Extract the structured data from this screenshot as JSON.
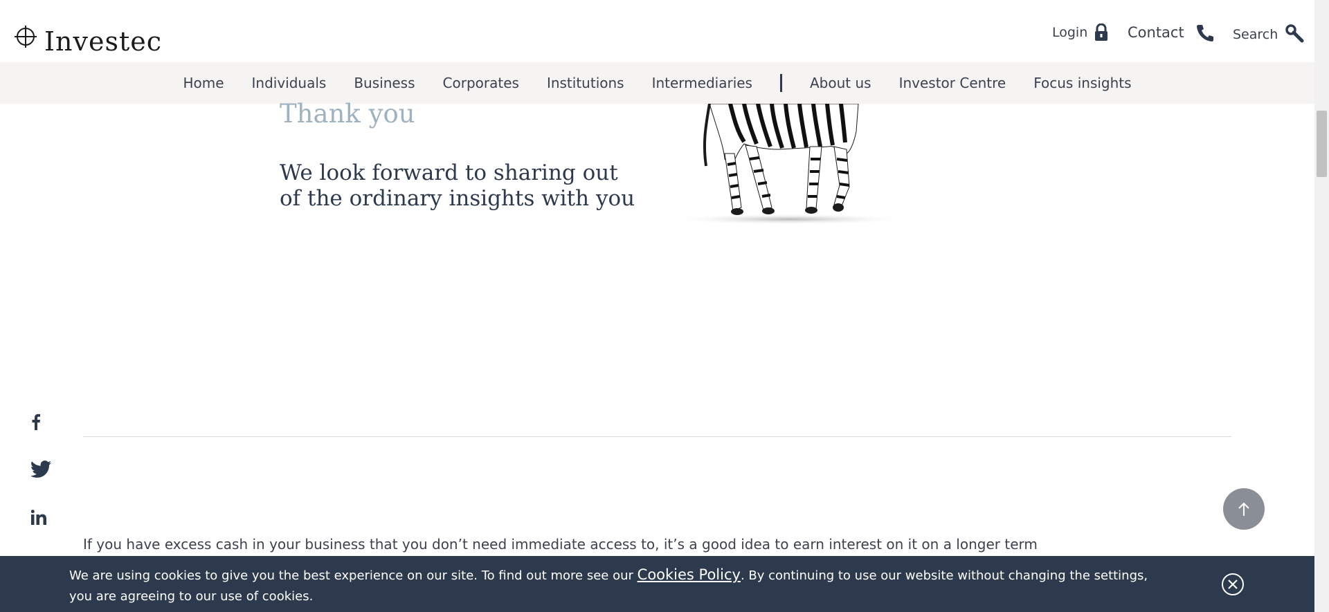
{
  "header": {
    "logo_text": "Investec",
    "login_label": "Login",
    "contact_label": "Contact",
    "search_label": "Search"
  },
  "nav": {
    "items": [
      "Home",
      "Individuals",
      "Business",
      "Corporates",
      "Institutions",
      "Intermediaries"
    ],
    "secondary_items": [
      "About us",
      "Investor Centre",
      "Focus insights"
    ]
  },
  "content": {
    "thanks_title": "Thank you",
    "thanks_body": "We look forward to sharing out of the ordinary insights with you",
    "body_text": "If you have excess cash in your business that you don’t need immediate access to, it’s a good idea to earn interest on it on a longer term"
  },
  "social": {
    "icons": [
      "facebook-icon",
      "twitter-icon",
      "linkedin-icon"
    ]
  },
  "cookie_bar": {
    "text_before": "We are using cookies to give you the best experience on our site. To find out more see our ",
    "link_label": "Cookies Policy",
    "text_after": ". By continuing to use our website without changing the settings, you are agreeing to our use of cookies."
  },
  "colors": {
    "nav_bg": "#f5f4f2",
    "cookie_bg": "#2d3a4d",
    "title_accent": "#9fb2bf",
    "back_to_top_bg": "#8a8f97"
  }
}
